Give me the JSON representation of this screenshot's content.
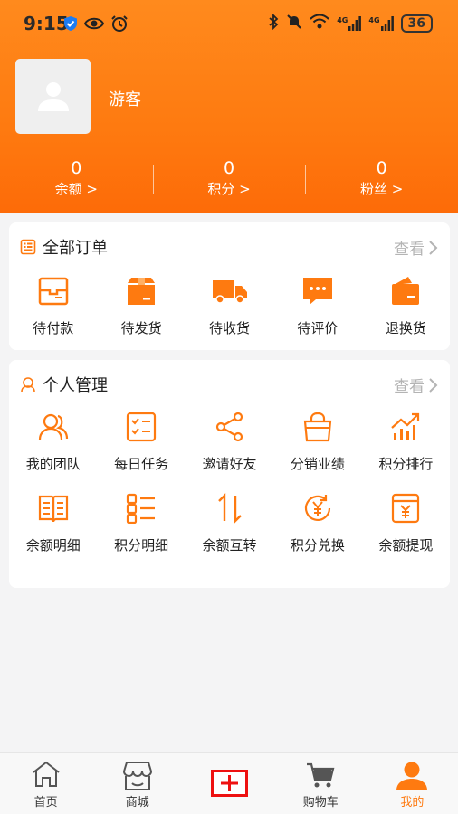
{
  "status_bar": {
    "time": "9:15",
    "network_1": "4G",
    "network_2": "4G",
    "battery": "36"
  },
  "profile": {
    "username": "游客"
  },
  "stats": [
    {
      "value": "0",
      "label": "余额 >"
    },
    {
      "value": "0",
      "label": "积分 >"
    },
    {
      "value": "0",
      "label": "粉丝 >"
    }
  ],
  "orders": {
    "title": "全部订单",
    "more": "查看",
    "items": [
      {
        "label": "待付款",
        "icon": "pending-payment-icon"
      },
      {
        "label": "待发货",
        "icon": "pending-shipment-icon"
      },
      {
        "label": "待收货",
        "icon": "delivery-truck-icon"
      },
      {
        "label": "待评价",
        "icon": "comment-icon"
      },
      {
        "label": "退换货",
        "icon": "wallet-return-icon"
      }
    ]
  },
  "manage": {
    "title": "个人管理",
    "more": "查看",
    "row1": [
      {
        "label": "我的团队",
        "icon": "team-icon"
      },
      {
        "label": "每日任务",
        "icon": "task-checklist-icon"
      },
      {
        "label": "邀请好友",
        "icon": "share-icon"
      },
      {
        "label": "分销业绩",
        "icon": "shopping-bag-icon"
      },
      {
        "label": "积分排行",
        "icon": "ranking-chart-icon"
      }
    ],
    "row2": [
      {
        "label": "余额明细",
        "icon": "ledger-book-icon"
      },
      {
        "label": "积分明细",
        "icon": "list-icon"
      },
      {
        "label": "余额互转",
        "icon": "transfer-arrows-icon"
      },
      {
        "label": "积分兑换",
        "icon": "yen-exchange-icon"
      },
      {
        "label": "余额提现",
        "icon": "withdraw-icon"
      }
    ]
  },
  "tabbar": {
    "items": [
      {
        "label": "首页",
        "icon": "home-icon"
      },
      {
        "label": "商城",
        "icon": "store-icon"
      },
      {
        "label": "",
        "icon": "add-plus-icon"
      },
      {
        "label": "购物车",
        "icon": "cart-icon"
      },
      {
        "label": "我的",
        "icon": "person-icon"
      }
    ]
  },
  "colors": {
    "accent": "#fe7a10",
    "header_top": "#ff8a1d",
    "background": "#f4f4f5",
    "muted": "#b4b4b4",
    "add_button_border": "#ee1111"
  }
}
